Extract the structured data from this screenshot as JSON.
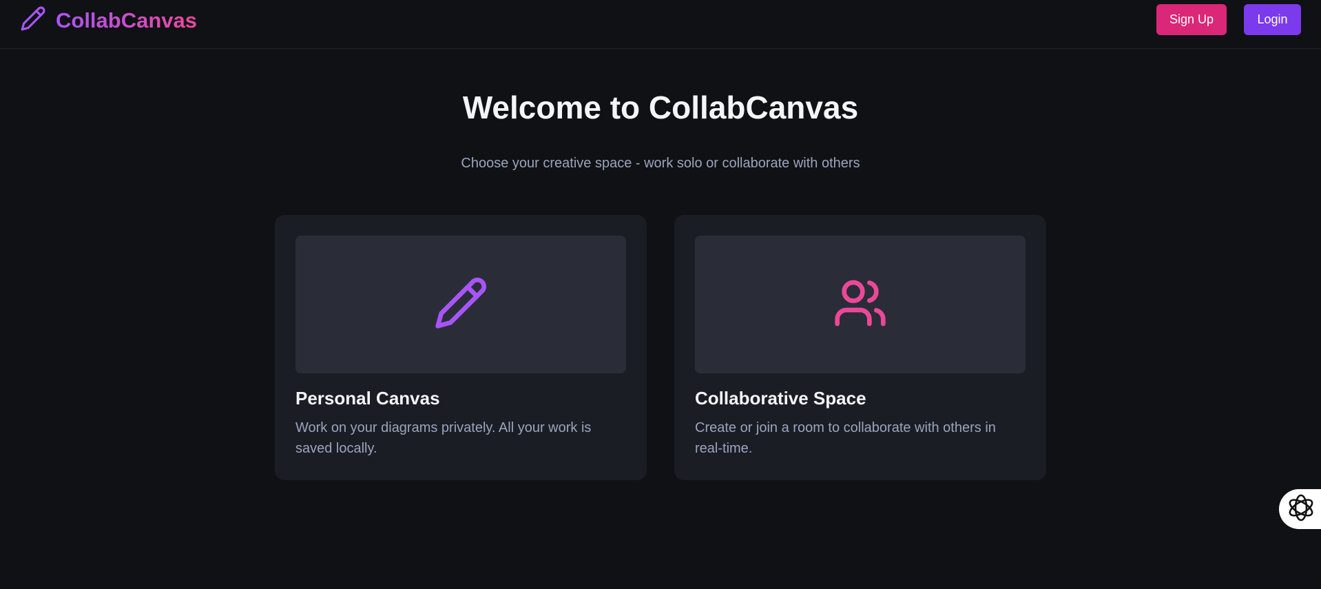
{
  "header": {
    "brand": "CollabCanvas",
    "signup_label": "Sign Up",
    "login_label": "Login"
  },
  "hero": {
    "title": "Welcome to CollabCanvas",
    "subtitle": "Choose your creative space - work solo or collaborate with others"
  },
  "cards": [
    {
      "icon": "pencil-icon",
      "title": "Personal Canvas",
      "description": "Work on your diagrams privately. All your work is saved locally."
    },
    {
      "icon": "users-icon",
      "title": "Collaborative Space",
      "description": "Create or join a room to collaborate with others in real-time."
    }
  ],
  "widget": {
    "icon": "openai-logo-icon"
  },
  "colors": {
    "background": "#101115",
    "purple_accent": "#a855f7",
    "pink_accent": "#ec4899",
    "signup_button": "#db2777",
    "login_button": "#7c3aed",
    "card": "#1b1d25",
    "card_media": "#2a2d38",
    "muted_text": "#9aa5bd"
  }
}
